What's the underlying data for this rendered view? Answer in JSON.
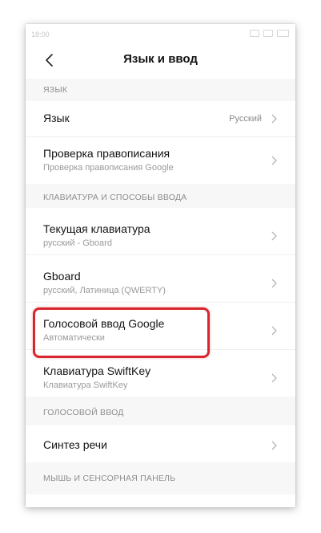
{
  "status": {
    "time": "18:00"
  },
  "header": {
    "title": "Язык и ввод"
  },
  "sections": [
    {
      "title": "ЯЗЫК",
      "rows": [
        {
          "title": "Язык",
          "value": "Русский"
        },
        {
          "title": "Проверка правописания",
          "subtitle": "Проверка правописания Google"
        }
      ]
    },
    {
      "title": "КЛАВИАТУРА И СПОСОБЫ ВВОДА",
      "rows": [
        {
          "title": "Текущая клавиатура",
          "subtitle": "русский - Gboard"
        },
        {
          "title": "Gboard",
          "subtitle": "русский, Латиница (QWERTY)"
        },
        {
          "title": "Голосовой ввод Google",
          "subtitle": "Автоматически"
        },
        {
          "title": "Клавиатура SwiftKey",
          "subtitle": "Клавиатура SwiftKey"
        }
      ]
    },
    {
      "title": "ГОЛОСОВОЙ ВВОД",
      "rows": [
        {
          "title": "Синтез речи"
        }
      ]
    },
    {
      "title": "МЫШЬ И СЕНСОРНАЯ ПАНЕЛЬ",
      "rows": []
    }
  ],
  "colors": {
    "highlight": "#d8262e",
    "section_bg": "#f7f7f7"
  }
}
